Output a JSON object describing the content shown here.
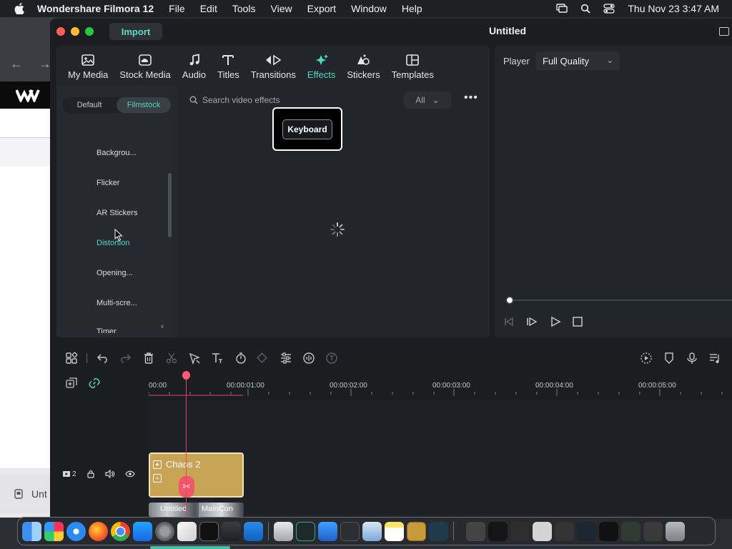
{
  "menubar": {
    "app_name": "Wondershare Filmora 12",
    "items": [
      "File",
      "Edit",
      "Tools",
      "View",
      "Export",
      "Window",
      "Help"
    ],
    "clock": "Thu Nov 23  3:47 AM"
  },
  "background_window": {
    "tab_label": "Unt"
  },
  "window": {
    "title": "Untitled",
    "import_label": "Import"
  },
  "media_tabs": [
    {
      "label": "My Media",
      "icon": "image-icon"
    },
    {
      "label": "Stock Media",
      "icon": "cloud-image-icon"
    },
    {
      "label": "Audio",
      "icon": "music-note-icon"
    },
    {
      "label": "Titles",
      "icon": "text-t-icon"
    },
    {
      "label": "Transitions",
      "icon": "transition-arrows-icon"
    },
    {
      "label": "Effects",
      "icon": "sparkle-icon",
      "active": true
    },
    {
      "label": "Stickers",
      "icon": "sticker-icon"
    },
    {
      "label": "Templates",
      "icon": "template-grid-icon"
    }
  ],
  "effects": {
    "segment": [
      "Default",
      "Filmstock"
    ],
    "active_segment": "Filmstock",
    "categories": [
      "Backgrou...",
      "Flicker",
      "AR Stickers",
      "Distortion",
      "Opening...",
      "Multi-scre...",
      "Timer"
    ],
    "active_category": "Distortion",
    "search_placeholder": "Search video effects",
    "filter_label": "All"
  },
  "tooltip": {
    "key_label": "Keyboard"
  },
  "player": {
    "label": "Player",
    "quality": "Full Quality"
  },
  "timeline": {
    "timecodes": [
      "00:00",
      "00:00:01:00",
      "00:00:02:00",
      "00:00:03:00",
      "00:00:04:00",
      "00:00:05:00"
    ],
    "track_number": "2",
    "clip_title": "Chaos 2",
    "clip2_labels": [
      "Untitled",
      "MainCon"
    ]
  },
  "colors": {
    "accent": "#4fd8c0",
    "playhead": "#ff5a6e",
    "clip": "#c8a354"
  }
}
